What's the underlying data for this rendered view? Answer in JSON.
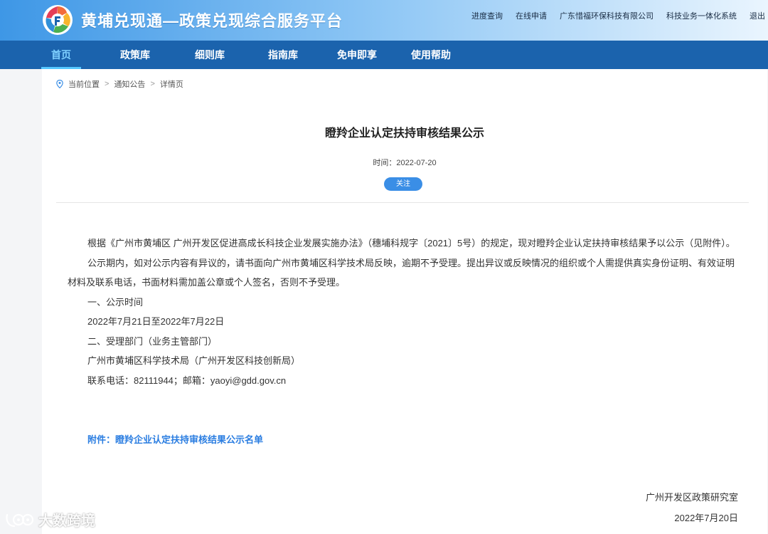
{
  "header": {
    "site_title": "黄埔兑现通—政策兑现综合服务平台",
    "top_links": [
      "进度查询",
      "在线申请",
      "广东惜福环保科技有限公司",
      "科技业务一体化系统",
      "退出"
    ]
  },
  "nav": {
    "items": [
      "首页",
      "政策库",
      "细则库",
      "指南库",
      "免申即享",
      "使用帮助"
    ],
    "active_index": 0
  },
  "breadcrumb": {
    "icon": "location-pin-icon",
    "items": [
      "当前位置",
      "通知公告",
      "详情页"
    ],
    "separator": ">"
  },
  "article": {
    "title": "瞪羚企业认定扶持审核结果公示",
    "time_label": "时间：",
    "time": "2022-07-20",
    "follow_label": "关注",
    "paragraphs": [
      "根据《广州市黄埔区 广州开发区促进高成长科技企业发展实施办法》（穗埔科规字〔2021〕5号）的规定，现对瞪羚企业认定扶持审核结果予以公示（见附件）。",
      "公示期内，如对公示内容有异议的，请书面向广州市黄埔区科学技术局反映，逾期不予受理。提出异议或反映情况的组织或个人需提供真实身份证明、有效证明材料及联系电话，书面材料需加盖公章或个人签名，否则不予受理。",
      "一、公示时间",
      "2022年7月21日至2022年7月22日",
      "二、受理部门（业务主管部门）",
      "广州市黄埔区科学技术局（广州开发区科技创新局）",
      "联系电话：82111944；邮箱：yaoyi@gdd.gov.cn"
    ],
    "attachment": "附件：瞪羚企业认定扶持审核结果公示名单",
    "sign_org": "广州开发区政策研究室",
    "sign_date": "2022年7月20日"
  },
  "watermark": {
    "text": "大数跨境",
    "icon": "brand-logo-icon"
  },
  "colors": {
    "nav_bg": "#1b63ad",
    "nav_active": "#7fd0ff",
    "accent": "#3a8ee6",
    "link": "#2a7de1"
  }
}
